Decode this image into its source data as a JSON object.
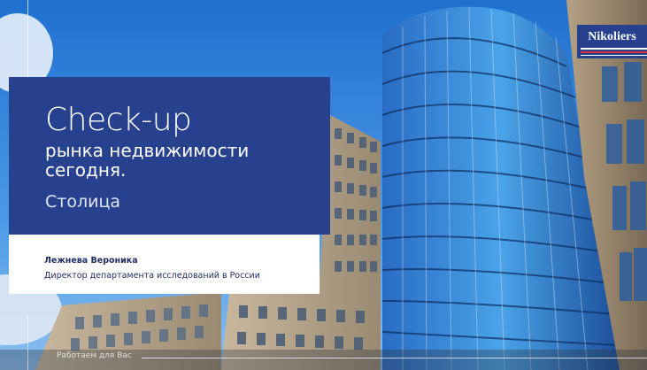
{
  "title": {
    "main": "Check-up",
    "subtitle_line1": "рынка недвижимости",
    "subtitle_line2": "сегодня.",
    "city": "Столица"
  },
  "author": {
    "name": "Лежнева Вероника",
    "role": "Директор департамента исследований в России"
  },
  "logo": {
    "text": "Nikoliers"
  },
  "footer": {
    "text": "Работаем для Вас"
  },
  "colors": {
    "brand_blue": "#27418f",
    "brand_red": "#d42b38",
    "sky": "#3c8fdc"
  }
}
